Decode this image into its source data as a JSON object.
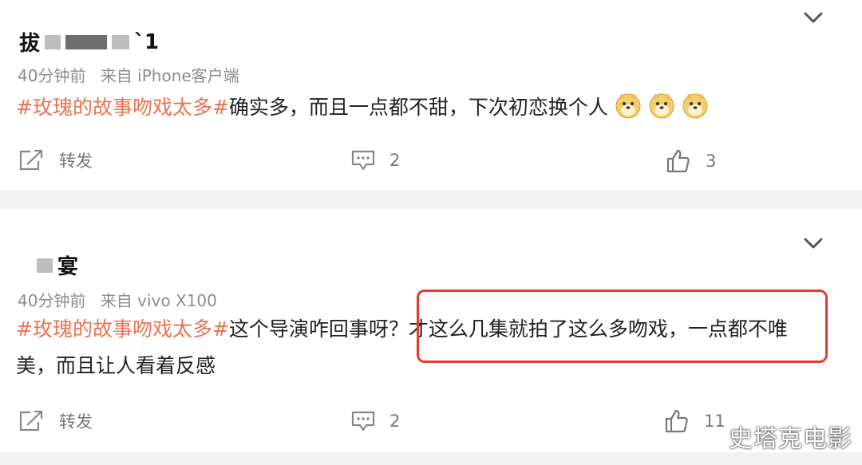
{
  "posts": [
    {
      "username_visible": "`1",
      "username_prefix": "拔",
      "time": "40分钟前",
      "source": "来自 iPhone客户端",
      "hashtag": "#玫瑰的故事吻戏太多#",
      "text": "确实多，而且一点都不甜，下次初恋换个人",
      "emoji_count": 3,
      "repost_label": "转发",
      "comment_count": "2",
      "like_count": "3"
    },
    {
      "username_visible": "宴",
      "time": "40分钟前",
      "source": "来自 vivo X100",
      "hashtag": "#玫瑰的故事吻戏太多#",
      "text": "这个导演咋回事呀？才这么几集就拍了这么多吻戏，一点都不唯美，而且让人看着反感",
      "repost_label": "转发",
      "comment_count": "2",
      "like_count": "11"
    }
  ],
  "watermark": "史塔克电影",
  "colors": {
    "hashtag": "#eb7350",
    "highlight": "#e33b2e",
    "icon": "#888888"
  },
  "icons": [
    "chevron-down-icon",
    "repost-icon",
    "comment-icon",
    "like-icon",
    "doge-emoji-icon"
  ]
}
